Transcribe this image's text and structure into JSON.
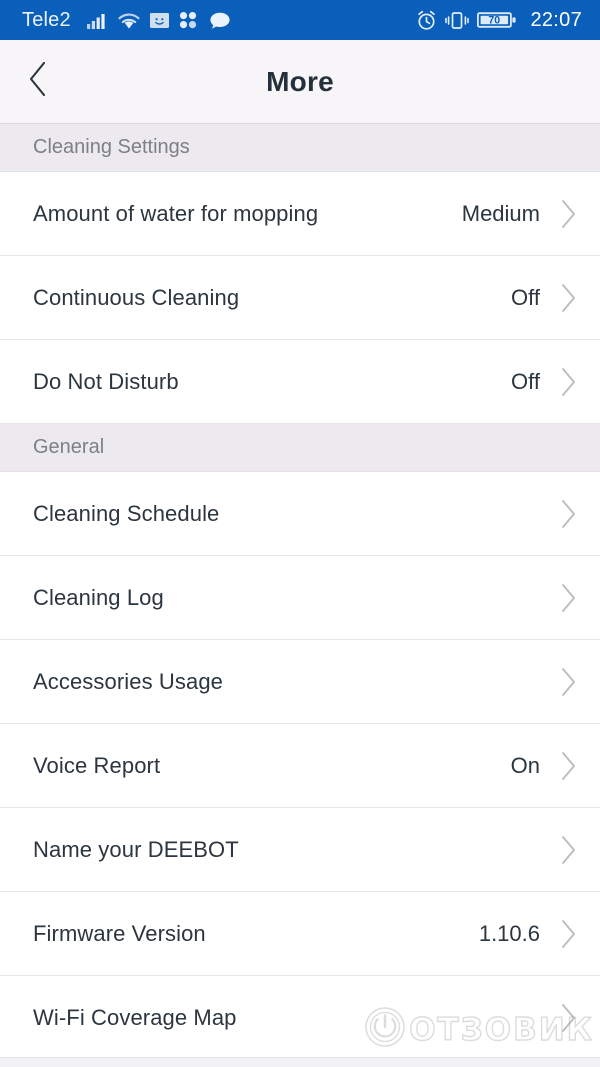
{
  "status_bar": {
    "carrier": "Tele2",
    "time": "22:07",
    "battery_level": "70",
    "icons": [
      "signal-bars-icon",
      "wifi-icon",
      "email-icon",
      "dots-app-icon",
      "chat-bubble-icon",
      "alarm-clock-icon",
      "vibrate-icon",
      "battery-icon"
    ],
    "background_color": "#0a5fba"
  },
  "app_bar": {
    "title": "More",
    "back_icon": "chevron-left-icon",
    "background_color": "#f7f5f7"
  },
  "sections": [
    {
      "title": "Cleaning Settings",
      "rows": [
        {
          "label": "Amount of water for mopping",
          "value": "Medium",
          "chevron": "chevron-right-icon"
        },
        {
          "label": "Continuous Cleaning",
          "value": "Off",
          "chevron": "chevron-right-icon"
        },
        {
          "label": "Do Not Disturb",
          "value": "Off",
          "chevron": "chevron-right-icon"
        }
      ]
    },
    {
      "title": "General",
      "rows": [
        {
          "label": "Cleaning Schedule",
          "value": "",
          "chevron": "chevron-right-icon"
        },
        {
          "label": "Cleaning Log",
          "value": "",
          "chevron": "chevron-right-icon"
        },
        {
          "label": "Accessories Usage",
          "value": "",
          "chevron": "chevron-right-icon"
        },
        {
          "label": "Voice Report",
          "value": "On",
          "chevron": "chevron-right-icon"
        },
        {
          "label": "Name your DEEBOT",
          "value": "",
          "chevron": "chevron-right-icon"
        },
        {
          "label": "Firmware Version",
          "value": "1.10.6",
          "chevron": "chevron-right-icon"
        },
        {
          "label": "Wi-Fi Coverage Map",
          "value": "",
          "chevron": "chevron-right-icon"
        }
      ]
    }
  ],
  "watermark": {
    "text": "ОТЗОВИК",
    "logo_icon": "power-circle-icon"
  },
  "colors": {
    "accent": "#0a5fba",
    "text_primary": "#2c3640",
    "text_muted": "#7f7f87",
    "section_bg": "#eceaef",
    "divider": "#e9e7ea"
  }
}
